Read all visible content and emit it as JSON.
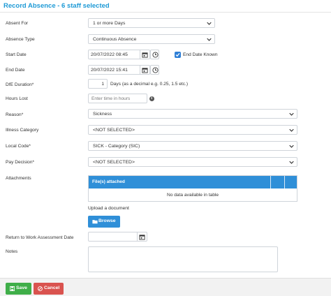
{
  "header": {
    "title": "Record Absence - 6 staff selected"
  },
  "form": {
    "absent_for": {
      "label": "Absent For",
      "value": "1 or more Days"
    },
    "absence_type": {
      "label": "Absence Type",
      "value": "Continuous Absence"
    },
    "start_date": {
      "label": "Start Date",
      "value": "20/07/2022 08:45"
    },
    "end_date_known": {
      "label": "End Date Known",
      "checked": true
    },
    "end_date": {
      "label": "End Date",
      "value": "20/07/2022 15:41"
    },
    "dfe_duration": {
      "label": "DfE Duration*",
      "value": "1",
      "hint": "Days (as a decimal e.g. 0.25, 1.5 etc.)"
    },
    "hours_lost": {
      "label": "Hours Lost",
      "placeholder": "Enter time in hours"
    },
    "reason": {
      "label": "Reason*",
      "value": "Sickness"
    },
    "illness_category": {
      "label": "Illness Category",
      "value": "<NOT SELECTED>"
    },
    "local_code": {
      "label": "Local Code*",
      "value": "SICK - Category (SIC)"
    },
    "pay_decision": {
      "label": "Pay Decision*",
      "value": "<NOT SELECTED>"
    },
    "attachments": {
      "label": "Attachments",
      "columns": [
        "File(s) attached"
      ],
      "empty_text": "No data available in table",
      "upload_label": "Upload a document",
      "browse_label": "Browse"
    },
    "rtw_date": {
      "label": "Return to Work Assessment Date",
      "value": ""
    },
    "notes": {
      "label": "Notes",
      "value": ""
    }
  },
  "footer": {
    "save_label": "Save",
    "cancel_label": "Cancel"
  },
  "colors": {
    "title": "#1e9ad6",
    "accent": "#2f8fd8",
    "save": "#3fae49",
    "cancel": "#d9534f"
  },
  "icons": [
    "chevron-down-icon",
    "calendar-icon",
    "clock-icon",
    "check-icon",
    "info-icon",
    "folder-icon",
    "save-icon",
    "cancel-icon"
  ]
}
